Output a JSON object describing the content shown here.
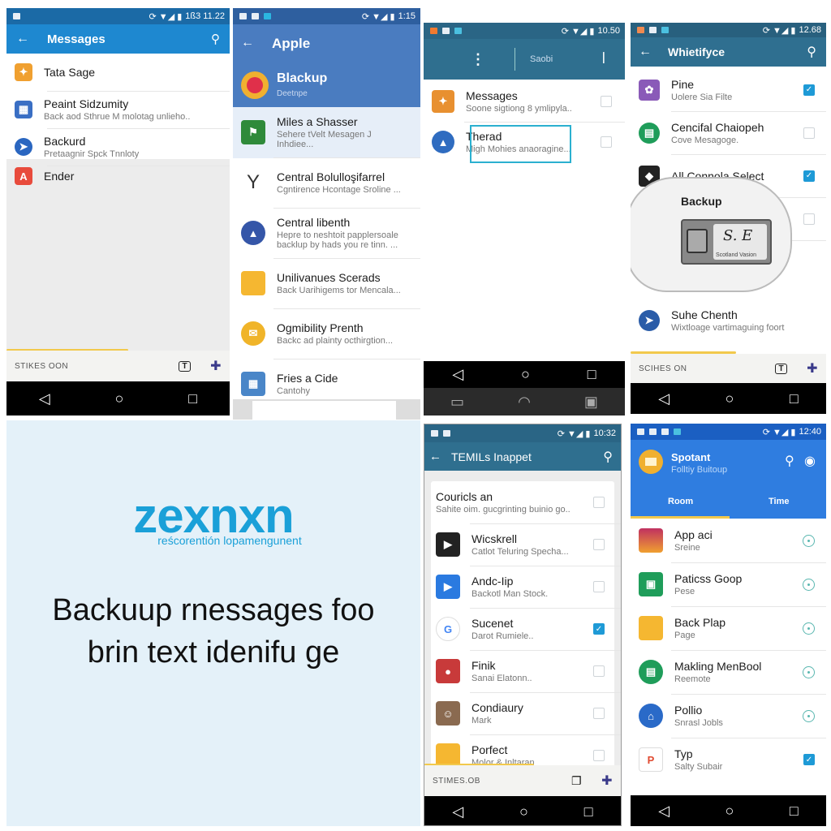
{
  "p1": {
    "status_time": "1ß3 11.22",
    "title": "Messages",
    "accent": "#1e88d0",
    "items": [
      {
        "title": "Tata Sage",
        "sub": "",
        "icon": "pinwheel-icon",
        "color": "#f0a030"
      },
      {
        "title": "Peaint Sidzumity",
        "sub": "Back aod Sthrue M molotag unlieho..",
        "icon": "image-icon",
        "color": "#3a6fc4"
      },
      {
        "title": "Backurd",
        "sub": "Pretaagnir Spck Tnnloty",
        "icon": "send-icon",
        "color": "#2a66c0"
      },
      {
        "title": "Ender",
        "sub": "",
        "icon": "app-icon",
        "color": "#e84b3c"
      }
    ],
    "bottom_label": "STIKES OON"
  },
  "p2": {
    "status_time": "1:15",
    "title": "Apple",
    "header_item": {
      "title": "Blackup",
      "sub": "Deetnpe"
    },
    "items": [
      {
        "title": "Miles a Shasser",
        "sub": "Sehere tVelt Mesagen J Inhdiee...",
        "icon": "flag-icon",
        "color": "#2f8a3a"
      },
      {
        "title": "Central Bolulloşifarrel",
        "sub": "Cgntirence Hcontage Sroline ...",
        "icon": "y-letter-icon",
        "color": "#333"
      },
      {
        "title": "Central libenth",
        "sub": "Hepre to neshtoit papplersoale backlup by hads you re tinn.  ...",
        "icon": "triangle-icon",
        "color": "#3556a8"
      },
      {
        "title": "Unilivanues Scerads",
        "sub": "Back Uarihigems tor Mencala...",
        "icon": "folder-icon",
        "color": "#f5b731"
      },
      {
        "title": "Ogmibility Prenth",
        "sub": "Backc ad plainty octhirgtion...",
        "icon": "mail-icon",
        "color": "#f0b429"
      },
      {
        "title": "Fries a Cide",
        "sub": "Cantohy",
        "icon": "image-icon",
        "color": "#4a86c8"
      }
    ]
  },
  "p3": {
    "status_time": "10.50",
    "search_label": "Saobi",
    "items": [
      {
        "title": "Messages",
        "sub": "Soone sigtiong 8 ymlipyla..",
        "icon": "pinwheel-icon",
        "color": "#e89030",
        "checked": false
      },
      {
        "title": "Therad",
        "sub": "Migh Mohies anaoragine...",
        "icon": "triangle-icon",
        "color": "#2f6cc0",
        "checked": false
      }
    ]
  },
  "p4": {
    "status_time": "12.68",
    "title": "Whietifyce",
    "items": [
      {
        "title": "Pine",
        "sub": "Uolere Sia Filte",
        "icon": "photo-icon",
        "color": "#8a5ab8",
        "checked": true
      },
      {
        "title": "Cencifal Chaiopeh",
        "sub": "Cove Mesagoge.",
        "icon": "chat-icon",
        "color": "#1f9d5a",
        "checked": false
      },
      {
        "title": "All Connola Select",
        "sub": "",
        "icon": "bell-icon",
        "color": "#222",
        "checked": true
      },
      {
        "title": "",
        "sub": "",
        "icon": "app-icon",
        "color": "#b03040",
        "checked": false
      },
      {
        "title": "Suhe Chenth",
        "sub": "Wixtloage vartimaguing foort",
        "icon": "send-icon",
        "color": "#2a5ca8",
        "checked": null
      }
    ],
    "popup": {
      "title": "Backup",
      "caption": "Scotland Vasion",
      "signature": "S. E"
    },
    "bottom_label": "SCIHES ON"
  },
  "p5": {
    "logo": "zexnxn",
    "tagline": "reścorentión lopamengunent",
    "headline_1": "Backuup rnessages foo",
    "headline_2": "brin text idenifu ge",
    "accent": "#1aa0d8"
  },
  "p6": {
    "status_time": "10:32",
    "title": "TEMILs Inappet",
    "items": [
      {
        "title": "Couricls an",
        "sub": "Sahite oim. gucgrinting buinio go..",
        "icon": "",
        "color": "",
        "checked": false
      },
      {
        "title": "Wicskrell",
        "sub": "Catlot Teluring Specha...",
        "icon": "play-store-icon",
        "color": "#222",
        "checked": false
      },
      {
        "title": "Andc-Iip",
        "sub": "Backotl Man Stock.",
        "icon": "play-icon",
        "color": "#2a7ae0",
        "checked": false
      },
      {
        "title": "Sucenet",
        "sub": "Darot Rumiele..",
        "icon": "google-icon",
        "color": "#fff",
        "checked": true
      },
      {
        "title": "Finik",
        "sub": "Sanai Elatonn..",
        "icon": "apple-icon",
        "color": "#c83a3a",
        "checked": false
      },
      {
        "title": "Condiaury",
        "sub": "Mark",
        "icon": "avatar-icon",
        "color": "#8a6a50",
        "checked": false
      },
      {
        "title": "Porfect",
        "sub": "Molor & Inltaran",
        "icon": "folder-icon",
        "color": "#f5b731",
        "checked": false
      }
    ],
    "bottom_label": "STIMES.OB"
  },
  "p7": {
    "status_time": "12:40",
    "title": "Spotant",
    "subtitle": "Folltiy Buitoup",
    "tabs": [
      "Room",
      "Time"
    ],
    "accent": "#2f7de0",
    "items": [
      {
        "title": "App aci",
        "sub": "Sreine",
        "icon": "gradient-icon",
        "color": "#d04060",
        "checked": false
      },
      {
        "title": "Paticss Goop",
        "sub": "Pese",
        "icon": "box-icon",
        "color": "#1f9d5a",
        "checked": false
      },
      {
        "title": "Back Plap",
        "sub": "Page",
        "icon": "folder-icon",
        "color": "#f5b731",
        "checked": false
      },
      {
        "title": "Makling MenBool",
        "sub": "Reemote",
        "icon": "chat-icon",
        "color": "#1f9d5a",
        "checked": false
      },
      {
        "title": "Pollio",
        "sub": "Snrasl Jobls",
        "icon": "pin-icon",
        "color": "#2a6ac8",
        "checked": false
      },
      {
        "title": "Typ",
        "sub": "Salty Subair",
        "icon": "pinterest-icon",
        "color": "#fff",
        "checked": true
      }
    ]
  }
}
